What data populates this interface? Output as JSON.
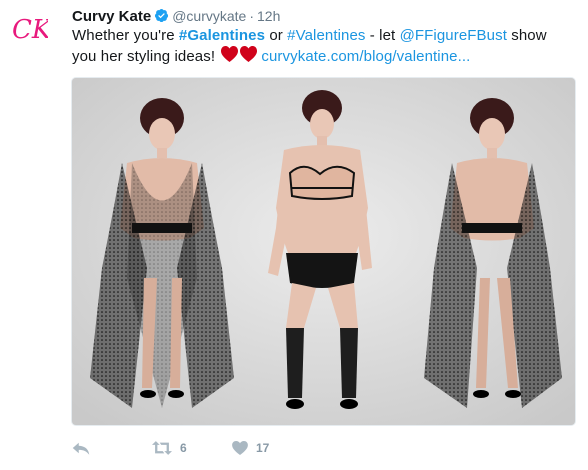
{
  "tweet": {
    "author": {
      "display_name": "Curvy Kate",
      "handle": "@curvykate",
      "avatar_initials": "CK",
      "verified": true
    },
    "separator": "·",
    "timestamp": "12h",
    "text": {
      "part1": "Whether you're ",
      "hashtag1": "#Galentines",
      "part2": " or ",
      "hashtag2": "#Valentines",
      "part3": " - let ",
      "mention": "@FFigureFBust",
      "part4": " show you her styling ideas! ",
      "link": "curvykate.com/blog/valentine..."
    },
    "actions": {
      "retweet_count": "6",
      "like_count": "17"
    },
    "colors": {
      "brand_pink": "#e8197d",
      "link_blue": "#1b95e0",
      "verified_blue": "#1da1f2",
      "heart_red": "#d0021b",
      "action_grey": "#aab8c2"
    }
  }
}
